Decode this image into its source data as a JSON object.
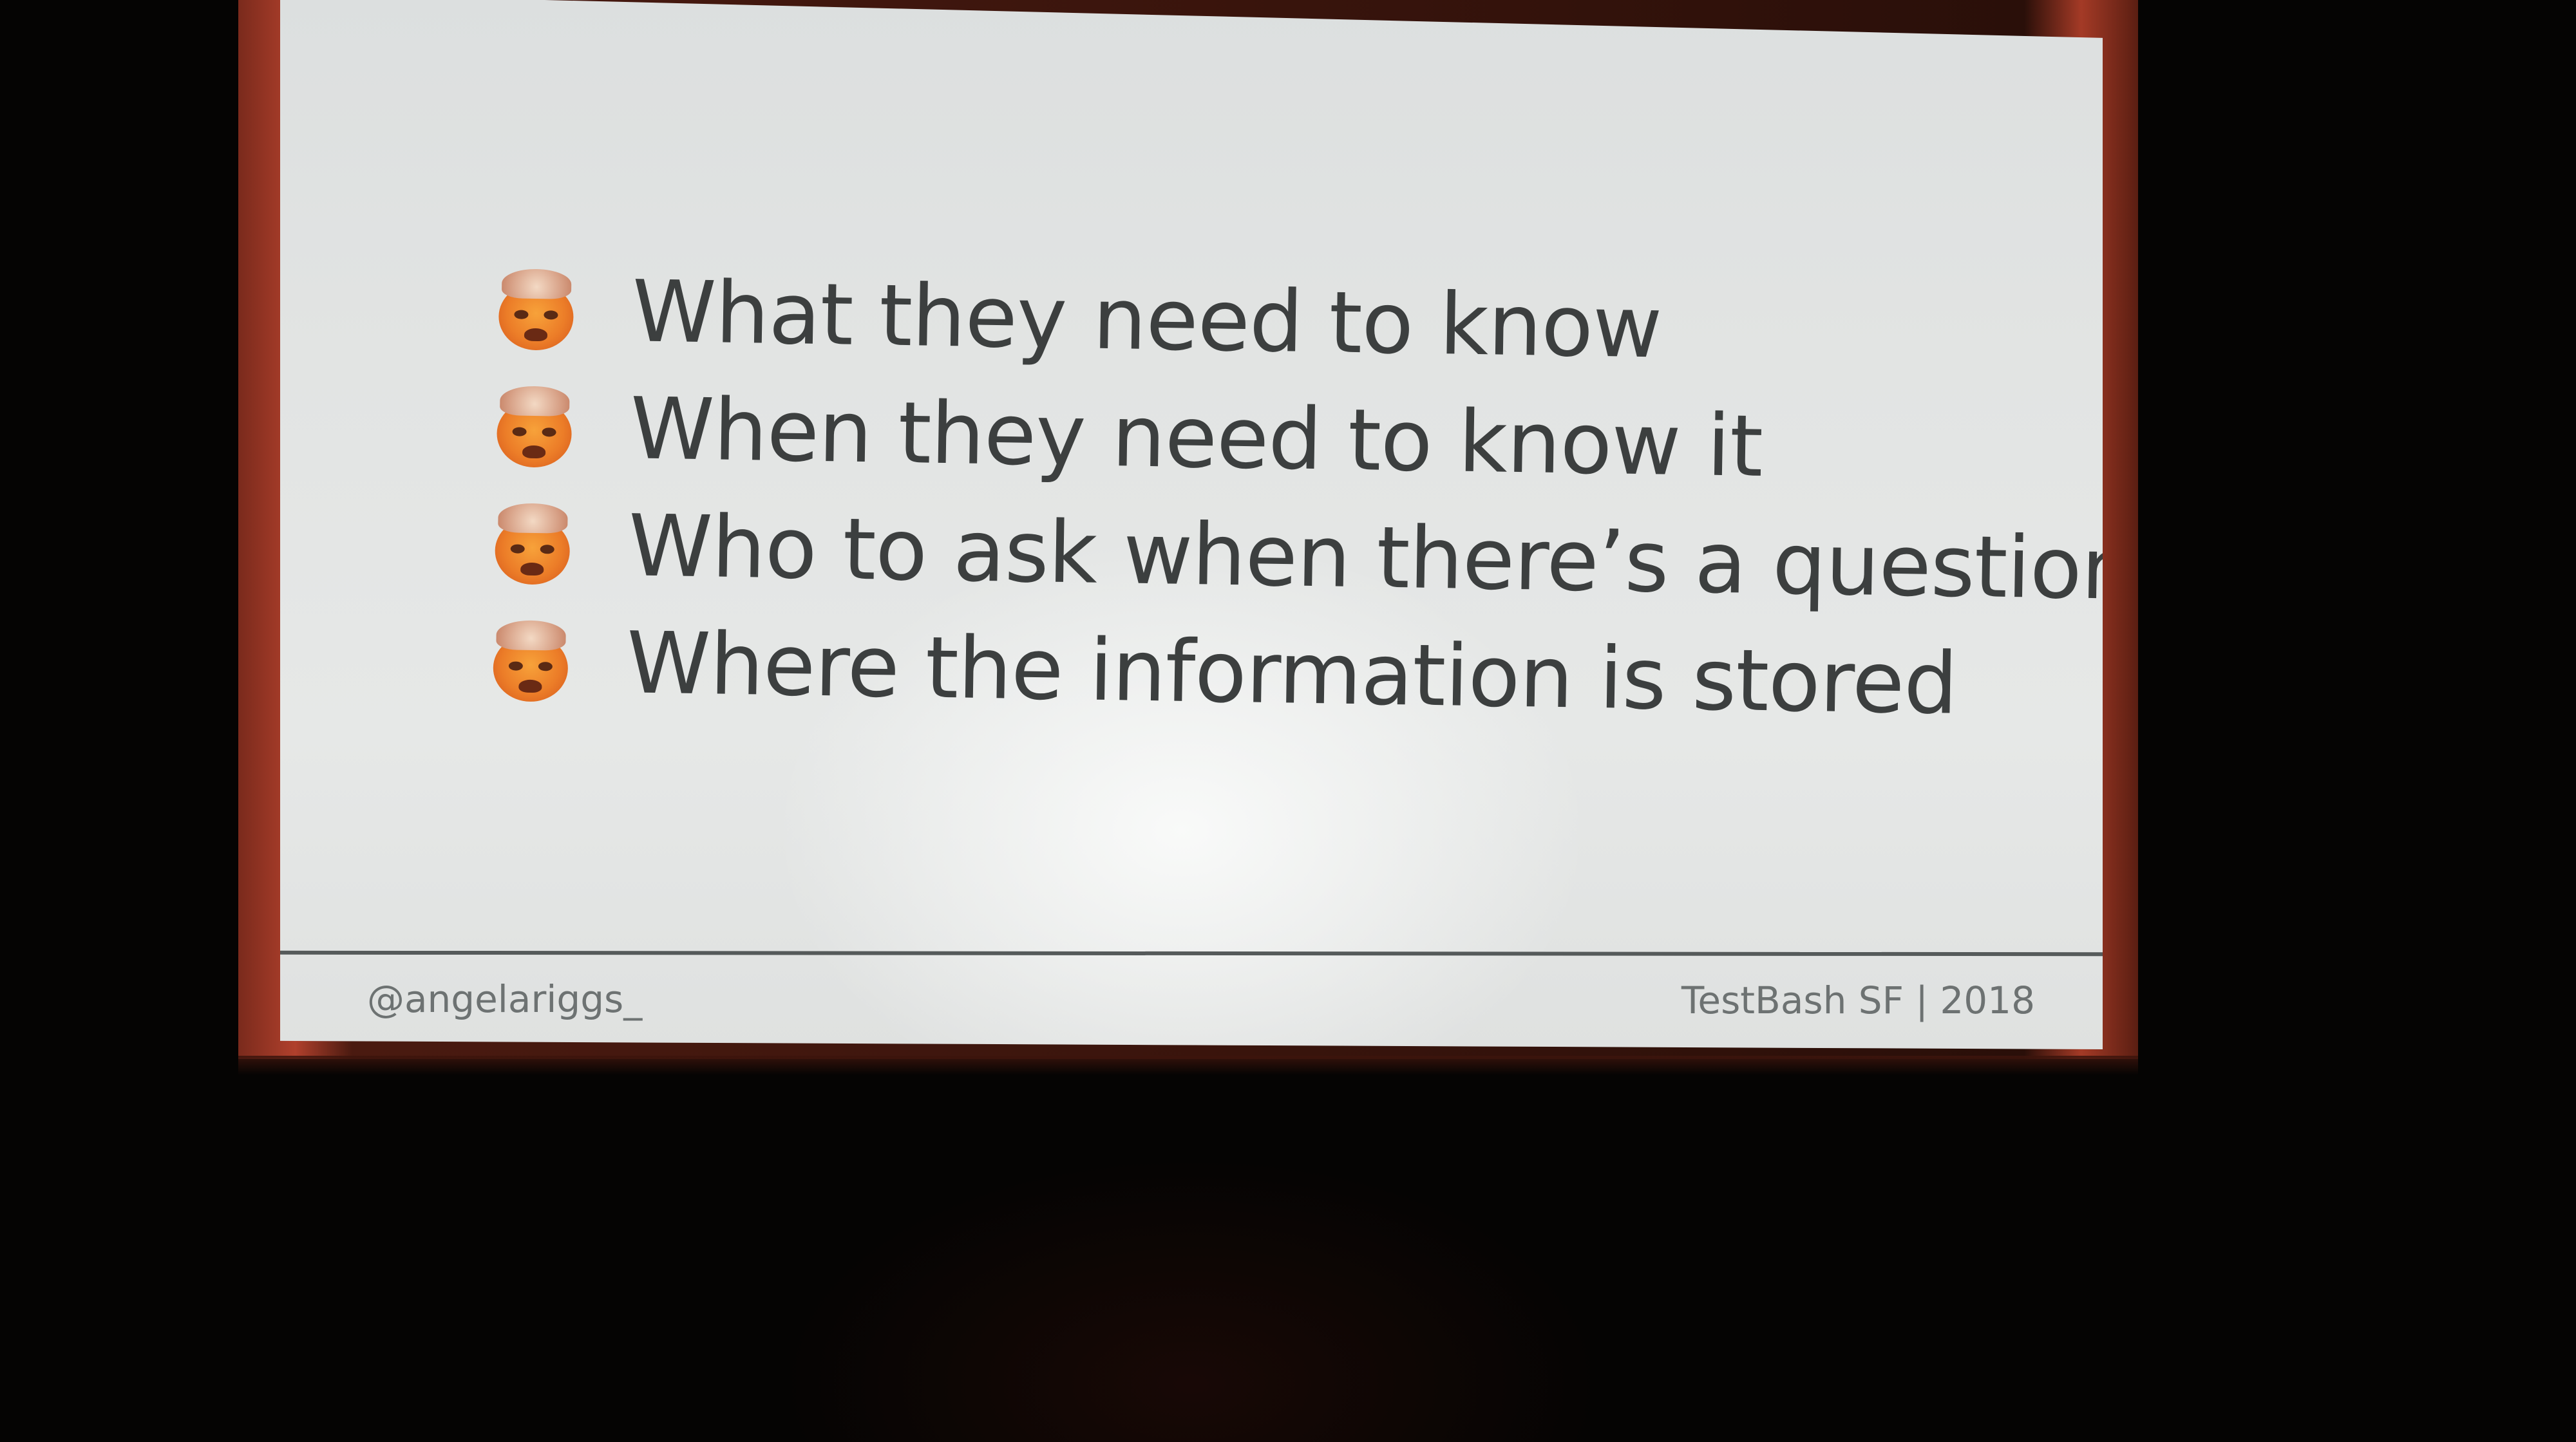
{
  "slide": {
    "bullets": [
      {
        "icon": "exploding-head-emoji-icon",
        "text": "What they need to know"
      },
      {
        "icon": "exploding-head-emoji-icon",
        "text": "When they need to know it"
      },
      {
        "icon": "exploding-head-emoji-icon",
        "text": "Who to ask when there’s a question"
      },
      {
        "icon": "exploding-head-emoji-icon",
        "text": "Where the information is stored"
      }
    ],
    "footer": {
      "handle": "@angelariggs_",
      "event": "TestBash SF | 2018"
    }
  },
  "colors": {
    "slide_background": "#e3e5e4",
    "text": "#3c3f3f",
    "footer_text": "#6d7272",
    "emoji_orange": "#ec7d28",
    "frame_red": "#b0402c"
  }
}
